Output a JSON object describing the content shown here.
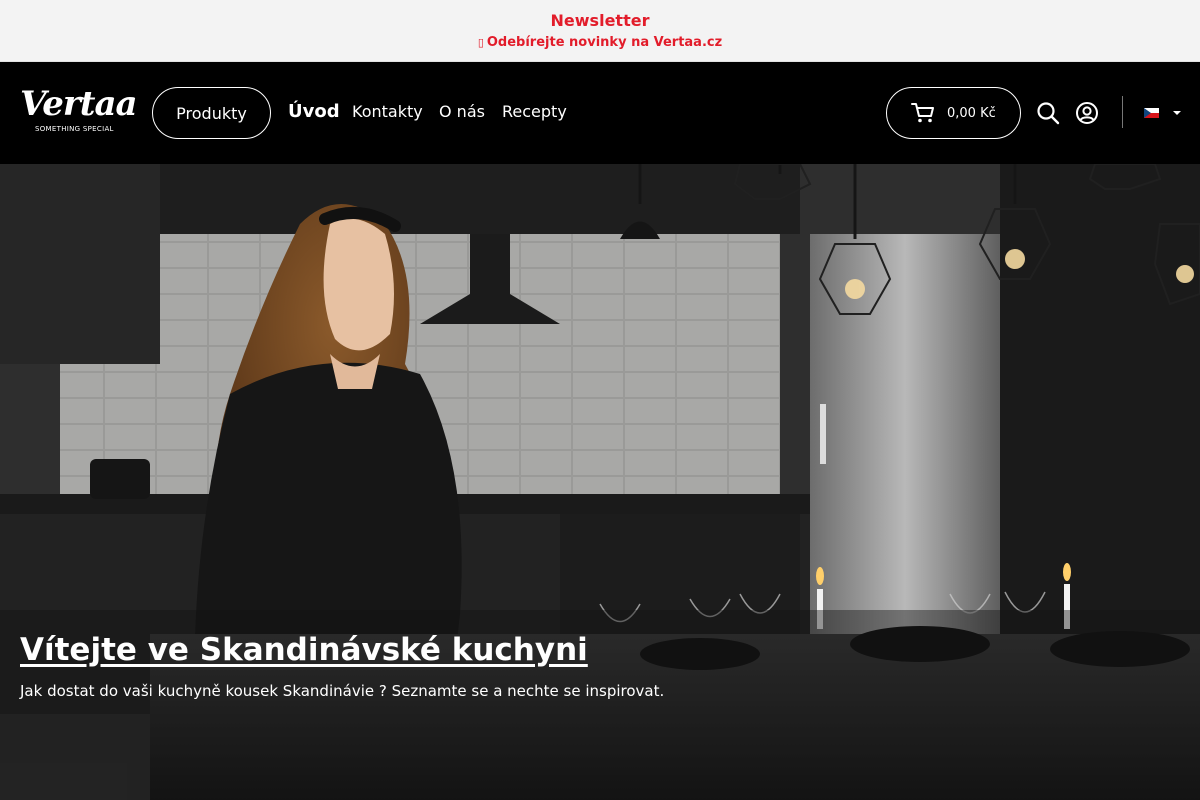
{
  "announcement": {
    "title": "Newsletter",
    "link_text": "Odebírejte novinky na Vertaa.cz",
    "link_glyph": "▯",
    "color": "#e21c2a"
  },
  "header": {
    "logo": {
      "wordmark": "Vertaa",
      "tagline": "SOMETHING SPECIAL"
    },
    "nav": {
      "products": "Produkty",
      "home": "Úvod",
      "contacts": "Kontakty",
      "about": "O nás",
      "recipes": "Recepty"
    },
    "cart": {
      "icon": "cart-icon",
      "total": "0,00 Kč"
    },
    "icons": {
      "search": "search-icon",
      "account": "user-circle-icon",
      "language": "flag-cz-icon"
    }
  },
  "hero": {
    "title": "Vítejte ve Skandinávské kuchyni",
    "subtitle": "Jak dostat do vaši kuchyně kousek Skandinávie ? Seznamte se a nechte se inspirovat."
  }
}
